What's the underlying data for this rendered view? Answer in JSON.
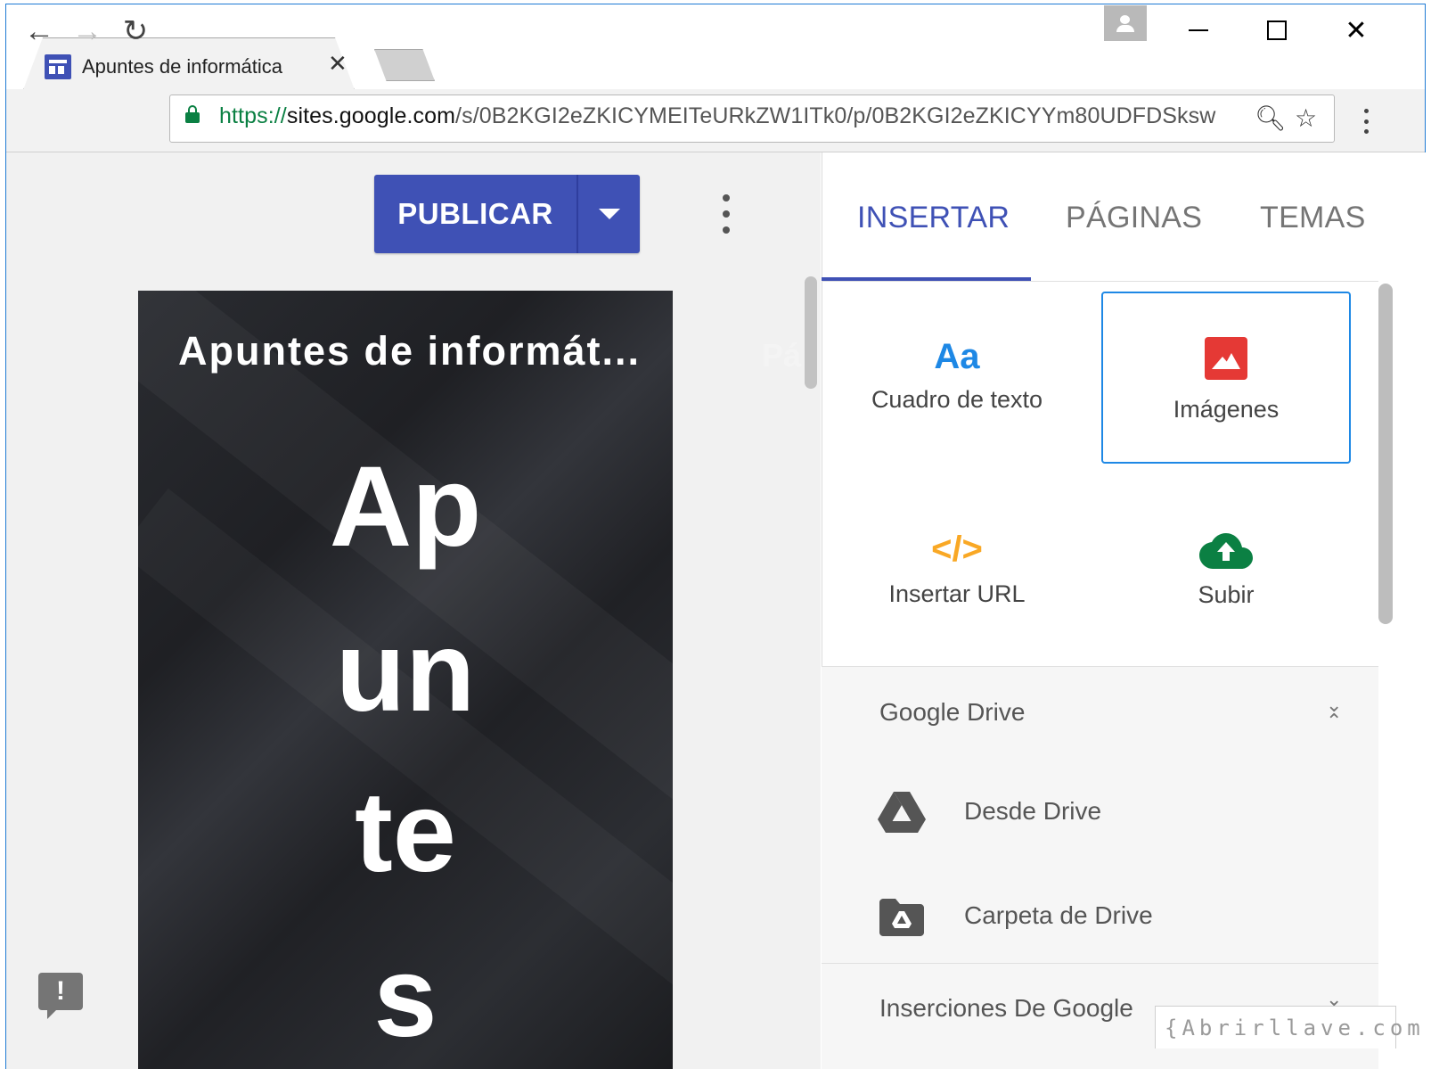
{
  "browser": {
    "tab_title": "Apuntes de informática",
    "tab_close": "✕",
    "url_protocol": "https://",
    "url_host": "sites.google.com",
    "url_path": "/s/0B2KGI2eZKICYMEITeURkZW1ITk0/p/0B2KGI2eZKICYYm80UDFDSksw",
    "back_glyph": "←",
    "forward_glyph": "→",
    "reload_glyph": "↻",
    "zoom_glyph": "🔍︎",
    "star_glyph": "☆",
    "close_glyph": "✕"
  },
  "editor": {
    "publish_label": "PUBLICAR",
    "site_name": "Apuntes de informát...",
    "nav_partial": "Pá",
    "hero_words": [
      "Ap",
      "un",
      "te",
      "s"
    ],
    "feedback_glyph": "!"
  },
  "panel": {
    "tabs": [
      "INSERTAR",
      "PÁGINAS",
      "TEMAS"
    ],
    "active_tab": "INSERTAR",
    "tiles": [
      {
        "label": "Cuadro de texto",
        "icon": "text-box-icon",
        "glyph": "Aa"
      },
      {
        "label": "Imágenes",
        "icon": "image-icon"
      },
      {
        "label": "Insertar URL",
        "icon": "code-icon",
        "glyph": "</>"
      },
      {
        "label": "Subir",
        "icon": "cloud-upload-icon"
      }
    ],
    "drive_section": {
      "title": "Google Drive",
      "items": [
        {
          "label": "Desde Drive",
          "icon": "google-drive-icon"
        },
        {
          "label": "Carpeta de Drive",
          "icon": "drive-folder-icon"
        }
      ]
    },
    "embeds_section": {
      "title": "Inserciones De Google"
    }
  },
  "watermark": "{Abrirllave.com",
  "colors": {
    "accent": "#3f51b5",
    "selected_border": "#1e88e5",
    "text_icon": "#1e88e5",
    "image_icon": "#e53935",
    "code_icon": "#f9a825",
    "upload_icon": "#0b8043",
    "lock": "#0b8043"
  }
}
